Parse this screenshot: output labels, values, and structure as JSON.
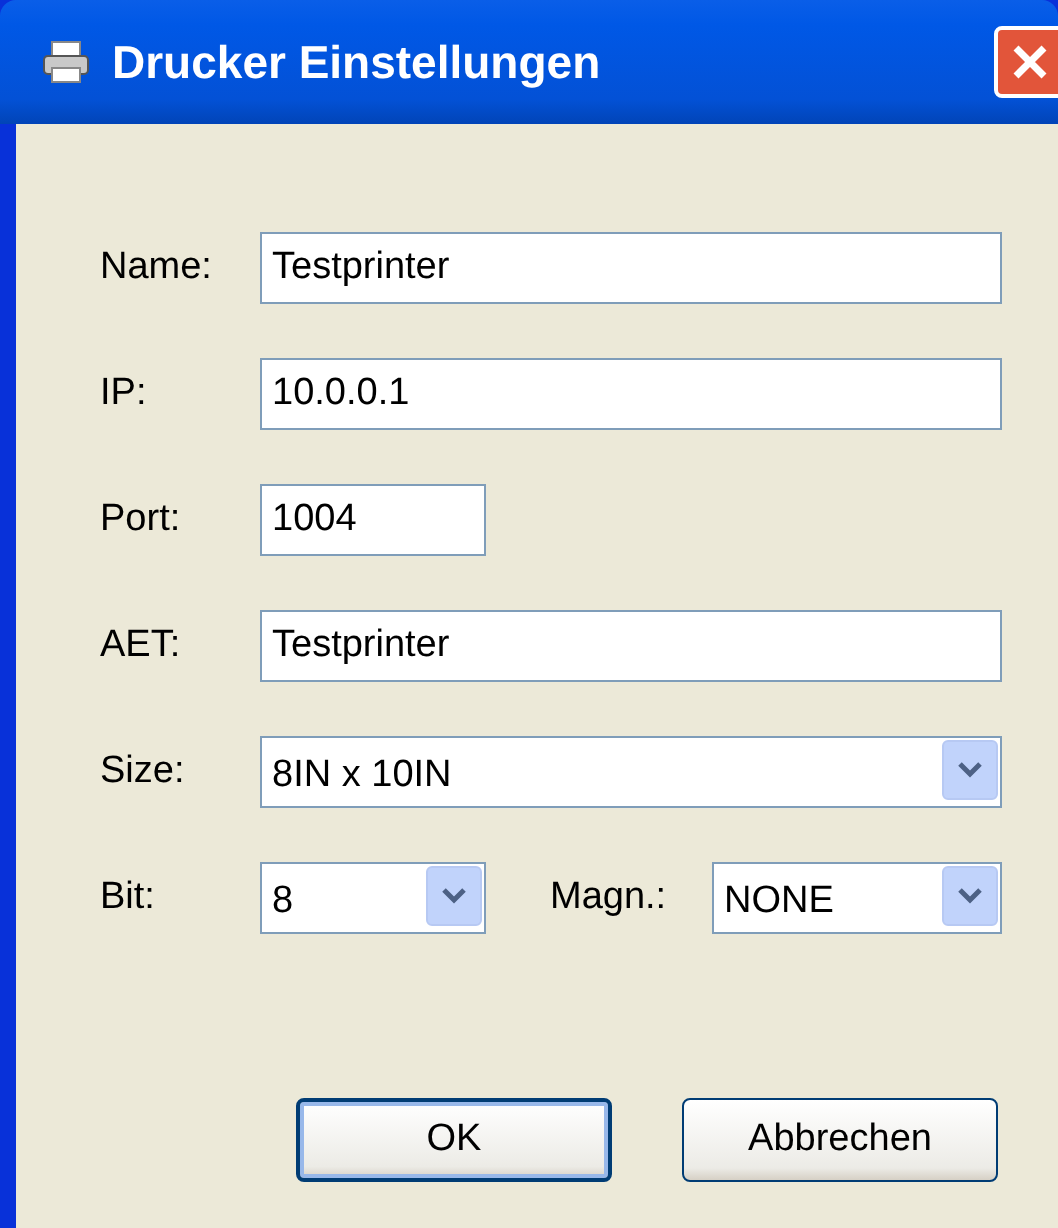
{
  "window": {
    "title": "Drucker Einstellungen"
  },
  "fields": [
    {
      "label": "Name:",
      "value": "Testprinter",
      "kind": "text"
    },
    {
      "label": "IP:",
      "value": "10.0.0.1",
      "kind": "text"
    },
    {
      "label": "Port:",
      "value": "1004",
      "kind": "short"
    },
    {
      "label": "AET:",
      "value": "Testprinter",
      "kind": "text"
    },
    {
      "label": "Size:",
      "value": "8IN x 10IN",
      "kind": "combo"
    }
  ],
  "bottom_row": [
    {
      "label": "Bit:",
      "value": "8"
    },
    {
      "label": "Magn.:",
      "value": "NONE"
    }
  ],
  "buttons": [
    {
      "label": "OK",
      "default": true
    },
    {
      "label": "Abbrechen",
      "default": false
    }
  ]
}
